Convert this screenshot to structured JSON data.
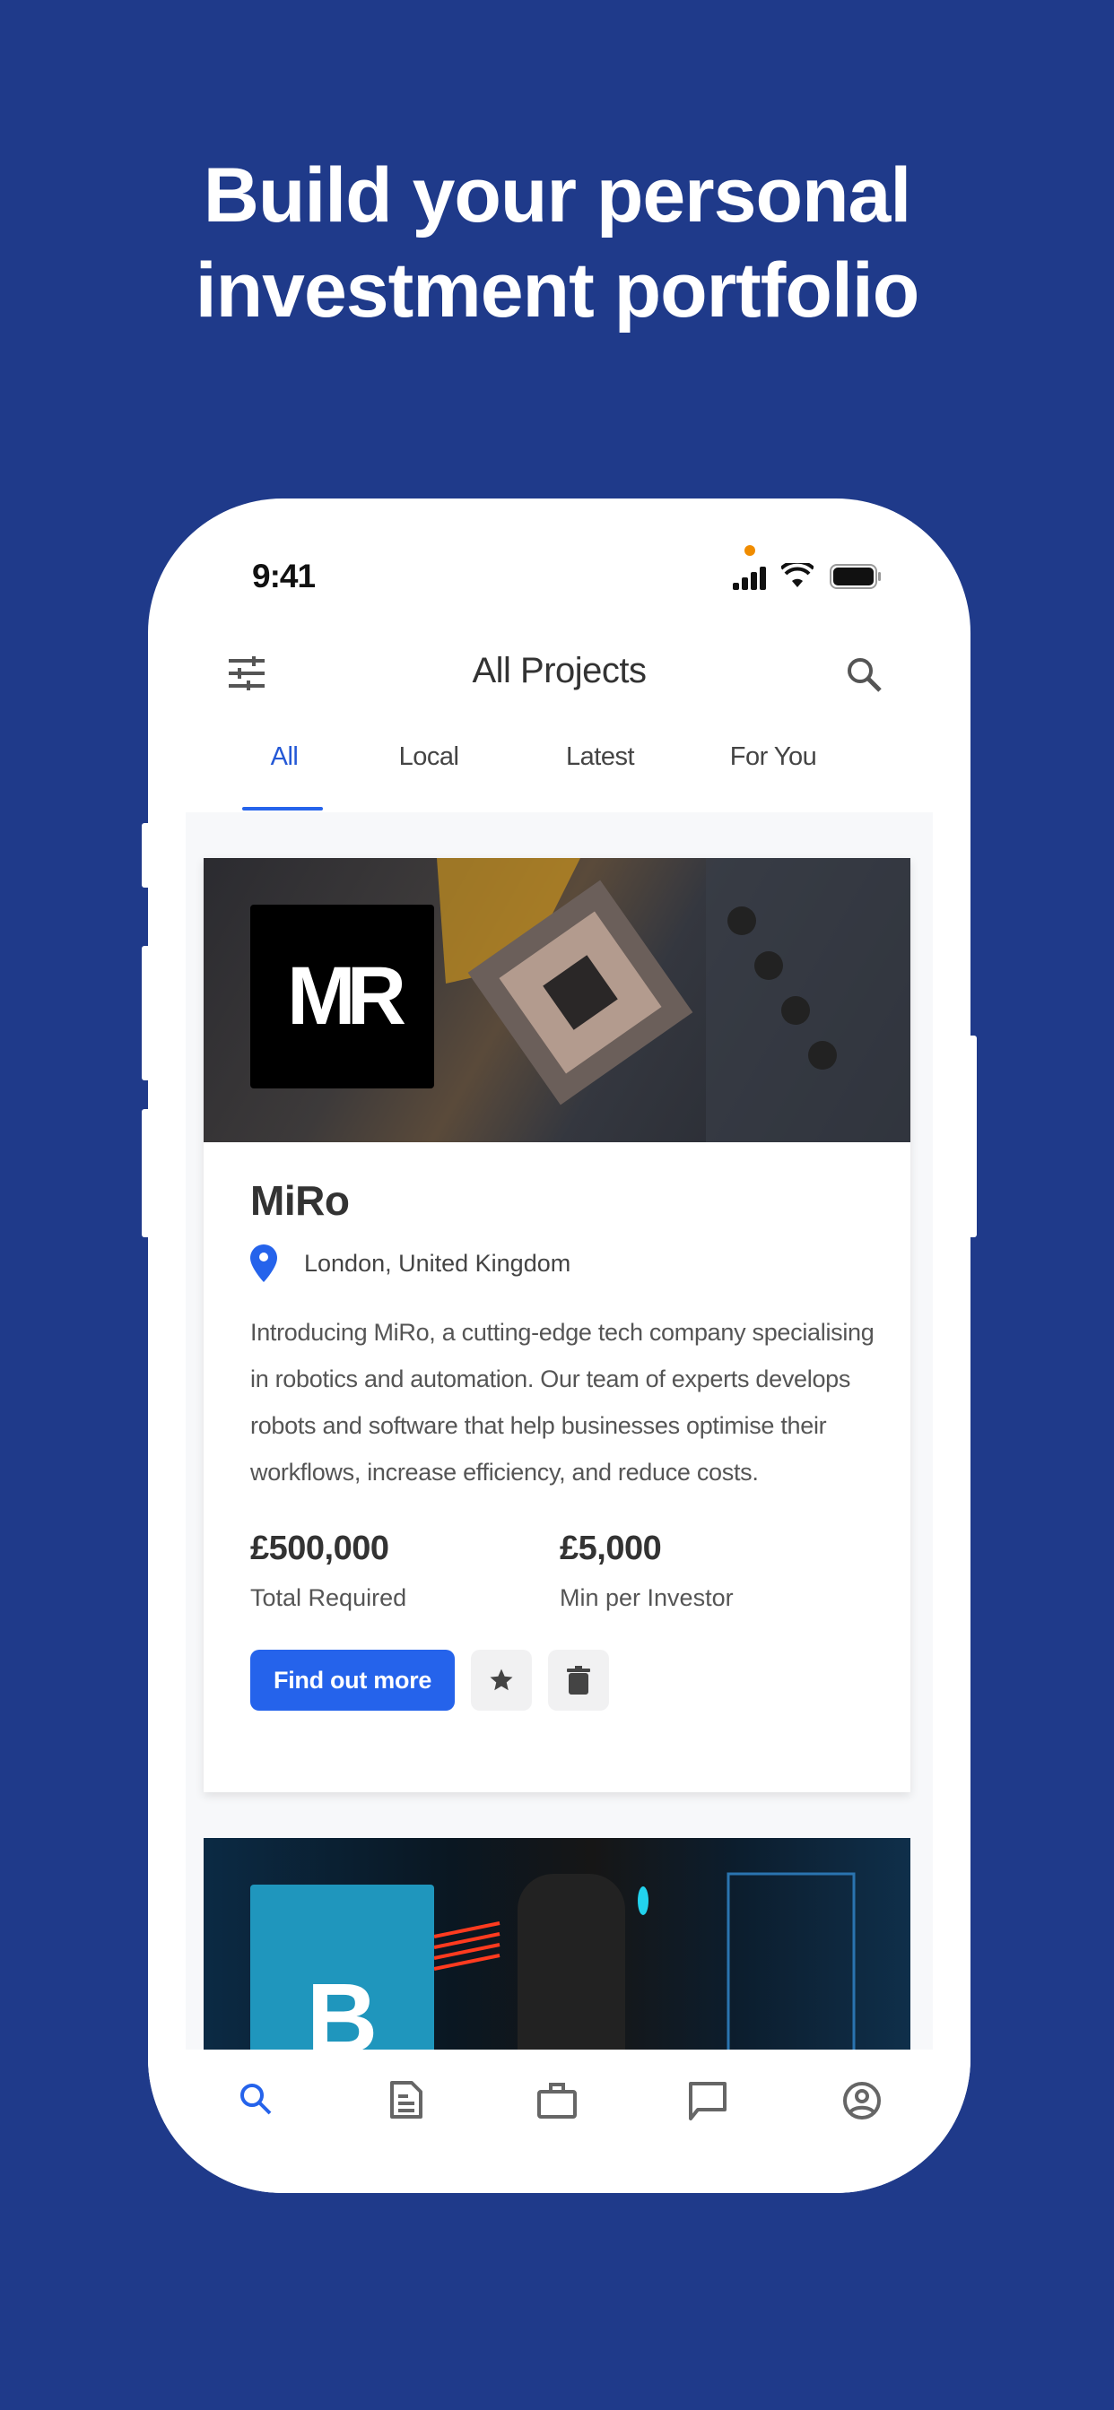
{
  "headline": [
    "Build your personal",
    "investment portfolio"
  ],
  "status_bar": {
    "time": "9:41"
  },
  "app_bar": {
    "title": "All Projects",
    "left_icon": "filter-sliders-icon",
    "right_icon": "search-icon"
  },
  "tabs": [
    {
      "label": "All",
      "active": true
    },
    {
      "label": "Local",
      "active": false
    },
    {
      "label": "Latest",
      "active": false
    },
    {
      "label": "For You",
      "active": false
    }
  ],
  "projects": [
    {
      "logo_text": "MR",
      "name": "MiRo",
      "location": "London, United Kingdom",
      "description": "Introducing MiRo, a cutting-edge tech company specialising in robotics and automation. Our team of experts develops robots and software that help businesses optimise their workflows, increase efficiency, and reduce costs.",
      "total_required": "£500,000",
      "total_required_label": "Total Required",
      "min_per_investor": "£5,000",
      "min_per_investor_label": "Min per Investor",
      "cta_label": "Find out more"
    },
    {
      "logo_text": "B"
    }
  ],
  "bottom_nav": [
    {
      "name": "search",
      "icon": "search-icon",
      "active": true
    },
    {
      "name": "documents",
      "icon": "document-icon",
      "active": false
    },
    {
      "name": "portfolio",
      "icon": "briefcase-icon",
      "active": false
    },
    {
      "name": "messages",
      "icon": "chat-icon",
      "active": false
    },
    {
      "name": "profile",
      "icon": "account-circle-icon",
      "active": false
    }
  ],
  "colors": {
    "background": "#1f3a8a",
    "accent": "#2563eb",
    "text": "#333333"
  }
}
